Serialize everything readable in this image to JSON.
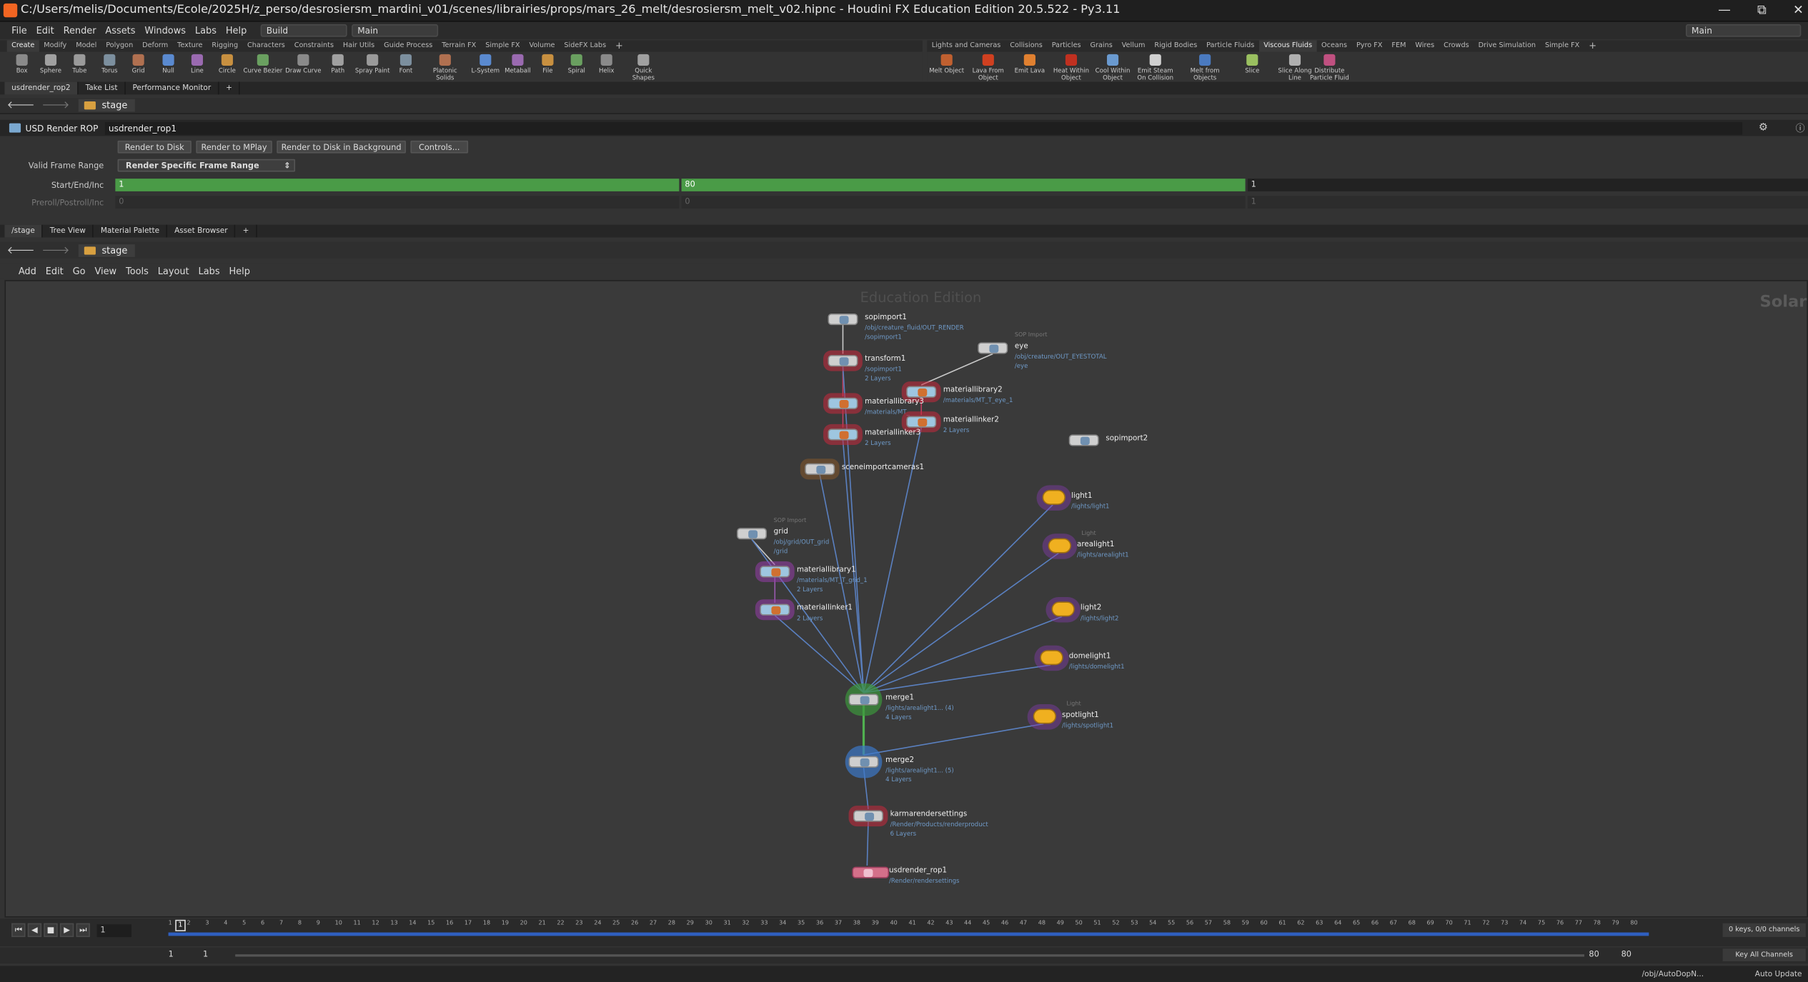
{
  "title_bar": {
    "title": "C:/Users/melis/Documents/Ecole/2025H/z_perso/desrosiersm_mardini_v01/scenes/librairies/props/mars_26_melt/desrosiersm_melt_v02.hipnc - Houdini FX Education Edition 20.5.522 - Py3.11"
  },
  "menu": {
    "items": [
      "File",
      "Edit",
      "Render",
      "Assets",
      "Windows",
      "Labs",
      "Help"
    ],
    "desktop": "Build",
    "context": "Main",
    "right_context": "Main"
  },
  "shelf_left": {
    "tabs": [
      "Create",
      "Modify",
      "Model",
      "Polygon",
      "Deform",
      "Texture",
      "Rigging",
      "Characters",
      "Constraints",
      "Hair Utils",
      "Guide Process",
      "Terrain FX",
      "Simple FX",
      "Volume",
      "SideFX Labs"
    ],
    "tools": [
      "Box",
      "Sphere",
      "Tube",
      "Torus",
      "Grid",
      "Null",
      "Line",
      "Circle",
      "Curve Bezier",
      "Draw Curve",
      "Path",
      "Spray Paint",
      "Font",
      "Platonic Solids",
      "L-System",
      "Metaball",
      "File",
      "Spiral",
      "Helix",
      "Quick Shapes"
    ]
  },
  "shelf_right": {
    "tabs": [
      "Lights and Cameras",
      "Collisions",
      "Particles",
      "Grains",
      "Vellum",
      "Rigid Bodies",
      "Particle Fluids",
      "Viscous Fluids",
      "Oceans",
      "Pyro FX",
      "FEM",
      "Wires",
      "Crowds",
      "Drive Simulation",
      "Simple FX"
    ],
    "active_tab": "Viscous Fluids",
    "tools": [
      "Melt Object",
      "Lava From Object",
      "Emit Lava",
      "Heat Within Object",
      "Cool Within Object",
      "Emit Steam On Collision",
      "Melt from Objects",
      "Slice",
      "Slice Along Line",
      "Distribute Particle Fluid"
    ]
  },
  "pane_top": {
    "tabs": [
      "usdrender_rop2",
      "Take List",
      "Performance Monitor"
    ],
    "path": "stage"
  },
  "rop": {
    "type_label": "USD Render ROP",
    "name": "usdrender_rop1",
    "buttons": [
      "Render to Disk",
      "Render to MPlay",
      "Render to Disk in Background",
      "Controls..."
    ],
    "valid_frame_range_label": "Valid Frame Range",
    "valid_frame_range": "Render Specific Frame Range",
    "start_end_inc_label": "Start/End/Inc",
    "start": "1",
    "end": "80",
    "inc": "1",
    "preroll_label": "Preroll/Postroll/Inc",
    "preroll": "0",
    "postroll": "0",
    "preroll_inc": "1"
  },
  "pane_bottom": {
    "tabs": [
      "/stage",
      "Tree View",
      "Material Palette",
      "Asset Browser"
    ],
    "path": "stage"
  },
  "network_menu": [
    "Add",
    "Edit",
    "Go",
    "View",
    "Tools",
    "Layout",
    "Labs",
    "Help"
  ],
  "network": {
    "watermark": "Education Edition",
    "context_label": "Solar",
    "nodes": {
      "sopimport1": {
        "label": "sopimport1",
        "sub": [
          "/obj/creature_fluid/OUT_RENDER",
          "/sopimport1"
        ]
      },
      "eye": {
        "type": "SOP Import",
        "label": "eye",
        "sub": [
          "/obj/creature/OUT_EYESTOTAL",
          "/eye"
        ]
      },
      "transform1": {
        "label": "transform1",
        "sub": [
          "/sopimport1",
          "2 Layers"
        ]
      },
      "materiallibrary2": {
        "label": "materiallibrary2",
        "sub": [
          "/materials/MT_T_eye_1"
        ]
      },
      "materiallibrary3": {
        "label": "materiallibrary3",
        "sub": [
          "/materials/MT_"
        ]
      },
      "materiallinker2": {
        "label": "materiallinker2",
        "sub": [
          "2 Layers"
        ]
      },
      "materiallinker3": {
        "label": "materiallinker3",
        "sub": [
          "2 Layers"
        ]
      },
      "sopimport2": {
        "label": "sopimport2"
      },
      "sceneimportcameras1": {
        "label": "sceneimportcameras1"
      },
      "grid": {
        "type": "SOP Import",
        "label": "grid",
        "sub": [
          "/obj/grid/OUT_grid",
          "/grid"
        ]
      },
      "materiallibrary1": {
        "label": "materiallibrary1",
        "sub": [
          "/materials/MT_T_grid_1",
          "2 Layers"
        ]
      },
      "materiallinker1": {
        "label": "materiallinker1",
        "sub": [
          "2 Layers"
        ]
      },
      "light1": {
        "label": "light1",
        "sub": [
          "/lights/light1"
        ]
      },
      "arealight1": {
        "type": "Light",
        "label": "arealight1",
        "sub": [
          "/lights/arealight1"
        ]
      },
      "light2": {
        "label": "light2",
        "sub": [
          "/lights/light2"
        ]
      },
      "domelight1": {
        "label": "domelight1",
        "sub": [
          "/lights/domelight1"
        ]
      },
      "spotlight1": {
        "type": "Light",
        "label": "spotlight1",
        "sub": [
          "/lights/spotlight1"
        ]
      },
      "merge1": {
        "label": "merge1",
        "sub": [
          "/lights/arealight1... (4)",
          "4 Layers"
        ]
      },
      "merge2": {
        "label": "merge2",
        "sub": [
          "/lights/arealight1... (5)",
          "4 Layers"
        ]
      },
      "karmarendersettings": {
        "label": "karmarendersettings",
        "sub": [
          "/Render/Products/renderproduct",
          "6 Layers"
        ]
      },
      "usdrender_rop1": {
        "label": "usdrender_rop1",
        "sub": [
          "/Render/rendersettings"
        ]
      }
    }
  },
  "playbar": {
    "current_frame": "1",
    "frame_field": "1",
    "keys": "0 keys, 0/0 channels",
    "key_all": "Key All Channels",
    "ticks": [
      "1",
      "2",
      "3",
      "4",
      "5",
      "6",
      "7",
      "8",
      "9",
      "10",
      "11",
      "12",
      "13",
      "14",
      "15",
      "16",
      "17",
      "18",
      "19",
      "20",
      "21",
      "22",
      "23",
      "24",
      "25",
      "26",
      "27",
      "28",
      "29",
      "30",
      "31",
      "32",
      "33",
      "34",
      "35",
      "36",
      "37",
      "38",
      "39",
      "40",
      "41",
      "42",
      "43",
      "44",
      "45",
      "46",
      "47",
      "48",
      "49",
      "50",
      "51",
      "52",
      "53",
      "54",
      "55",
      "56",
      "57",
      "58",
      "59",
      "60",
      "61",
      "62",
      "63",
      "64",
      "65",
      "66",
      "67",
      "68",
      "69",
      "70",
      "71",
      "72",
      "73",
      "74",
      "75",
      "76",
      "77",
      "78",
      "79",
      "80"
    ]
  },
  "range": {
    "start": "1",
    "start2": "1",
    "end": "80",
    "end2": "80"
  },
  "status": {
    "path": "/obj/AutoDopN...",
    "update_mode": "Auto Update"
  }
}
